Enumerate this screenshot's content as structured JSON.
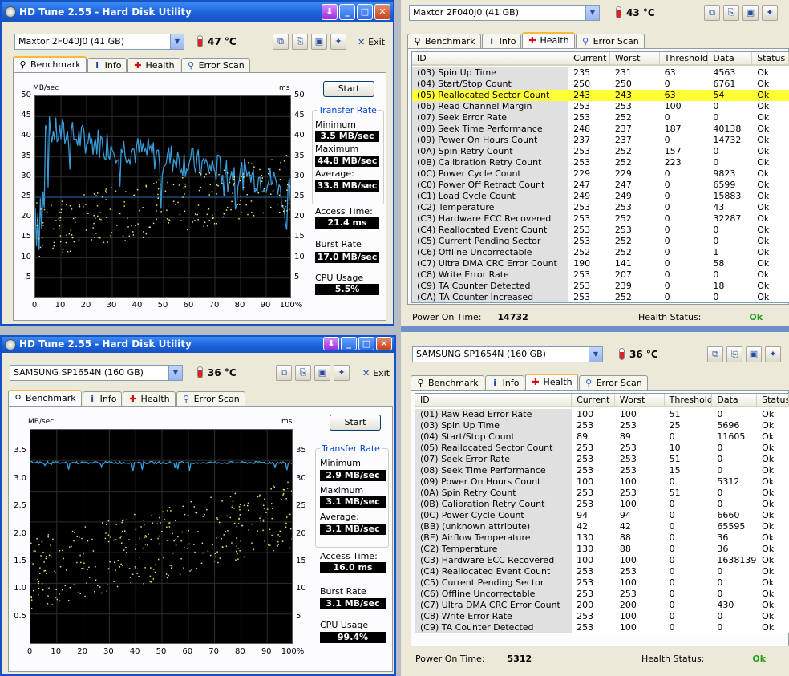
{
  "win1": {
    "title": "HD Tune 2.55 - Hard Disk Utility",
    "drive": "Maxtor 2F040J0 (41 GB)",
    "temp": "47 °C",
    "exit": "Exit",
    "tabs": [
      "Benchmark",
      "Info",
      "Health",
      "Error Scan"
    ],
    "start": "Start",
    "ylabel_left": "MB/sec",
    "ylabel_right": "ms",
    "yticks": [
      "50",
      "45",
      "40",
      "35",
      "30",
      "25",
      "20",
      "15",
      "10",
      "5"
    ],
    "xticks": [
      "0",
      "10",
      "20",
      "30",
      "40",
      "50",
      "60",
      "70",
      "80",
      "90",
      "100%"
    ],
    "group_title": "Transfer Rate",
    "minimum_label": "Minimum",
    "minimum": "3.5 MB/sec",
    "maximum_label": "Maximum",
    "maximum": "44.8 MB/sec",
    "average_label": "Average:",
    "average": "33.8 MB/sec",
    "access_label": "Access Time:",
    "access": "21.4 ms",
    "burst_label": "Burst Rate",
    "burst": "17.0 MB/sec",
    "cpu_label": "CPU Usage",
    "cpu": "5.5%"
  },
  "win2": {
    "title": "HD Tune 2.55 - Hard Disk Utility",
    "drive": "SAMSUNG SP1654N (160 GB)",
    "temp": "36 °C",
    "exit": "Exit",
    "tabs": [
      "Benchmark",
      "Info",
      "Health",
      "Error Scan"
    ],
    "start": "Start",
    "ylabel_left": "MB/sec",
    "ylabel_right": "ms",
    "yticks": [
      "3.5",
      "3.0",
      "2.5",
      "2.0",
      "1.5",
      "1.0",
      "0.5"
    ],
    "yticks_right": [
      "35",
      "30",
      "25",
      "20",
      "15",
      "10",
      "5"
    ],
    "xticks": [
      "0",
      "10",
      "20",
      "30",
      "40",
      "50",
      "60",
      "70",
      "80",
      "90",
      "100%"
    ],
    "group_title": "Transfer Rate",
    "minimum_label": "Minimum",
    "minimum": "2.9 MB/sec",
    "maximum_label": "Maximum",
    "maximum": "3.1 MB/sec",
    "average_label": "Average:",
    "average": "3.1 MB/sec",
    "access_label": "Access Time:",
    "access": "16.0 ms",
    "burst_label": "Burst Rate",
    "burst": "3.1 MB/sec",
    "cpu_label": "CPU Usage",
    "cpu": "99.4%"
  },
  "win3": {
    "drive": "Maxtor 2F040J0 (41 GB)",
    "temp": "43 °C",
    "tabs": [
      "Benchmark",
      "Info",
      "Health",
      "Error Scan"
    ],
    "columns": [
      "ID",
      "Current",
      "Worst",
      "Threshold",
      "Data",
      "Status"
    ],
    "rows": [
      [
        "(03) Spin Up Time",
        "235",
        "231",
        "63",
        "4563",
        "Ok"
      ],
      [
        "(04) Start/Stop Count",
        "250",
        "250",
        "0",
        "6761",
        "Ok"
      ],
      [
        "(05) Reallocated Sector Count",
        "243",
        "243",
        "63",
        "54",
        "Ok"
      ],
      [
        "(06) Read Channel Margin",
        "253",
        "253",
        "100",
        "0",
        "Ok"
      ],
      [
        "(07) Seek Error Rate",
        "253",
        "252",
        "0",
        "0",
        "Ok"
      ],
      [
        "(08) Seek Time Performance",
        "248",
        "237",
        "187",
        "40138",
        "Ok"
      ],
      [
        "(09) Power On Hours Count",
        "237",
        "237",
        "0",
        "14732",
        "Ok"
      ],
      [
        "(0A) Spin Retry Count",
        "253",
        "252",
        "157",
        "0",
        "Ok"
      ],
      [
        "(0B) Calibration Retry Count",
        "253",
        "252",
        "223",
        "0",
        "Ok"
      ],
      [
        "(0C) Power Cycle Count",
        "229",
        "229",
        "0",
        "9823",
        "Ok"
      ],
      [
        "(C0) Power Off Retract Count",
        "247",
        "247",
        "0",
        "6599",
        "Ok"
      ],
      [
        "(C1) Load Cycle Count",
        "249",
        "249",
        "0",
        "15883",
        "Ok"
      ],
      [
        "(C2) Temperature",
        "253",
        "253",
        "0",
        "43",
        "Ok"
      ],
      [
        "(C3) Hardware ECC Recovered",
        "253",
        "252",
        "0",
        "32287",
        "Ok"
      ],
      [
        "(C4) Reallocated Event Count",
        "253",
        "253",
        "0",
        "0",
        "Ok"
      ],
      [
        "(C5) Current Pending Sector",
        "253",
        "252",
        "0",
        "0",
        "Ok"
      ],
      [
        "(C6) Offline Uncorrectable",
        "252",
        "252",
        "0",
        "1",
        "Ok"
      ],
      [
        "(C7) Ultra DMA CRC Error Count",
        "190",
        "141",
        "0",
        "58",
        "Ok"
      ],
      [
        "(C8) Write Error Rate",
        "253",
        "207",
        "0",
        "0",
        "Ok"
      ],
      [
        "(C9) TA Counter Detected",
        "253",
        "239",
        "0",
        "18",
        "Ok"
      ],
      [
        "(CA) TA Counter Increased",
        "253",
        "252",
        "0",
        "0",
        "Ok"
      ]
    ],
    "highlight_row": 2,
    "power_on_label": "Power On Time:",
    "power_on": "14732",
    "health_label": "Health Status:",
    "health": "Ok"
  },
  "win4": {
    "drive": "SAMSUNG SP1654N (160 GB)",
    "temp": "36 °C",
    "tabs": [
      "Benchmark",
      "Info",
      "Health",
      "Error Scan"
    ],
    "columns": [
      "ID",
      "Current",
      "Worst",
      "Threshold",
      "Data",
      "Status"
    ],
    "rows": [
      [
        "(01) Raw Read Error Rate",
        "100",
        "100",
        "51",
        "0",
        "Ok"
      ],
      [
        "(03) Spin Up Time",
        "253",
        "253",
        "25",
        "5696",
        "Ok"
      ],
      [
        "(04) Start/Stop Count",
        "89",
        "89",
        "0",
        "11605",
        "Ok"
      ],
      [
        "(05) Reallocated Sector Count",
        "253",
        "253",
        "10",
        "0",
        "Ok"
      ],
      [
        "(07) Seek Error Rate",
        "253",
        "253",
        "51",
        "0",
        "Ok"
      ],
      [
        "(08) Seek Time Performance",
        "253",
        "253",
        "15",
        "0",
        "Ok"
      ],
      [
        "(09) Power On Hours Count",
        "100",
        "100",
        "0",
        "5312",
        "Ok"
      ],
      [
        "(0A) Spin Retry Count",
        "253",
        "253",
        "51",
        "0",
        "Ok"
      ],
      [
        "(0B) Calibration Retry Count",
        "253",
        "100",
        "0",
        "0",
        "Ok"
      ],
      [
        "(0C) Power Cycle Count",
        "94",
        "94",
        "0",
        "6660",
        "Ok"
      ],
      [
        "(BB) (unknown attribute)",
        "42",
        "42",
        "0",
        "65595",
        "Ok"
      ],
      [
        "(BE) Airflow Temperature",
        "130",
        "88",
        "0",
        "36",
        "Ok"
      ],
      [
        "(C2) Temperature",
        "130",
        "88",
        "0",
        "36",
        "Ok"
      ],
      [
        "(C3) Hardware ECC Recovered",
        "100",
        "100",
        "0",
        "1638139",
        "Ok"
      ],
      [
        "(C4) Reallocated Event Count",
        "253",
        "253",
        "0",
        "0",
        "Ok"
      ],
      [
        "(C5) Current Pending Sector",
        "253",
        "100",
        "0",
        "0",
        "Ok"
      ],
      [
        "(C6) Offline Uncorrectable",
        "253",
        "253",
        "0",
        "0",
        "Ok"
      ],
      [
        "(C7) Ultra DMA CRC Error Count",
        "200",
        "200",
        "0",
        "430",
        "Ok"
      ],
      [
        "(C8) Write Error Rate",
        "253",
        "100",
        "0",
        "0",
        "Ok"
      ],
      [
        "(C9) TA Counter Detected",
        "253",
        "100",
        "0",
        "0",
        "Ok"
      ]
    ],
    "power_on_label": "Power On Time:",
    "power_on": "5312",
    "health_label": "Health Status:",
    "health": "Ok"
  },
  "colors": {
    "title_blue": "#1a5fd8",
    "highlight": "#ffff33",
    "ok_green": "#20a020",
    "trace_blue": "#3a9ad6",
    "dot_yellow": "#e6e66a"
  },
  "icons": {
    "tab_icons": [
      "benchmark-icon",
      "info-icon",
      "health-cross-icon",
      "error-scan-icon"
    ]
  }
}
